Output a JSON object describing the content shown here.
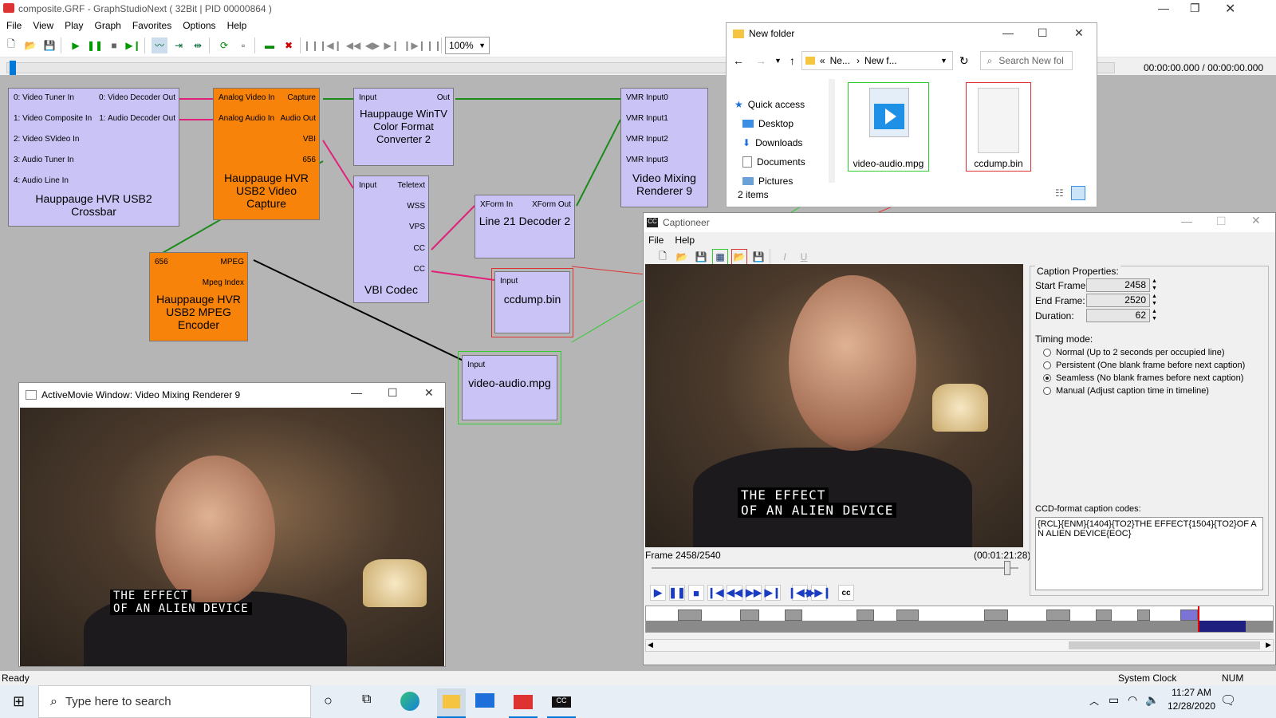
{
  "gsn": {
    "title": "composite.GRF - GraphStudioNext ( 32Bit | PID 00000864 )",
    "menu": [
      "File",
      "View",
      "Play",
      "Graph",
      "Favorites",
      "Options",
      "Help"
    ],
    "zoom": "100%",
    "time": "00:00:00.000 / 00:00:00.000",
    "status": "Ready",
    "status_clock": "System Clock",
    "status_num": "NUM"
  },
  "filters": {
    "crossbar": {
      "name": "Hauppauge HVR USB2 Crossbar",
      "pins_in": [
        "0: Video Tuner In",
        "1: Video Composite In",
        "2: Video SVideo In",
        "3: Audio Tuner In",
        "4: Audio Line In"
      ],
      "pins_out": [
        "0: Video Decoder Out",
        "1: Audio Decoder Out"
      ]
    },
    "capture": {
      "name": "Hauppauge HVR USB2 Video Capture",
      "pins_in": [
        "Analog Video In",
        "Analog Audio In"
      ],
      "pins_out": [
        "Capture",
        "Audio Out",
        "VBI",
        "656"
      ]
    },
    "color": {
      "name": "Hauppauge WinTV Color Format Converter 2",
      "pin_in": "Input",
      "pin_out": "Out"
    },
    "vbi": {
      "name": "VBI Codec",
      "pin_in": "Input",
      "pins_out": [
        "Teletext",
        "WSS",
        "VPS",
        "CC",
        "CC"
      ]
    },
    "line21": {
      "name": "Line 21 Decoder 2",
      "pin_in": "XForm In",
      "pin_out": "XForm Out"
    },
    "vmr": {
      "name": "Video Mixing Renderer 9",
      "pins_in": [
        "VMR Input0",
        "VMR Input1",
        "VMR Input2",
        "VMR Input3"
      ]
    },
    "mpeg": {
      "name": "Hauppauge HVR USB2 MPEG Encoder",
      "pin_in": "656",
      "pins_out": [
        "MPEG",
        "Mpeg Index"
      ]
    },
    "ccdump": {
      "name": "ccdump.bin",
      "pin_in": "Input"
    },
    "vamp": {
      "name": "video-audio.mpg",
      "pin_in": "Input"
    }
  },
  "activemovie": {
    "title": "ActiveMovie Window: Video Mixing Renderer 9",
    "caption_line1": "THE EFFECT",
    "caption_line2": "OF AN ALIEN DEVICE"
  },
  "explorer": {
    "title": "New folder",
    "crumb1": "Ne...",
    "crumb2": "New f...",
    "search_placeholder": "Search New fol",
    "nav": [
      "Quick access",
      "Desktop",
      "Downloads",
      "Documents",
      "Pictures"
    ],
    "files": [
      "video-audio.mpg",
      "ccdump.bin"
    ],
    "count": "2 items"
  },
  "captioneer": {
    "title": "Captioneer",
    "menu": [
      "File",
      "Help"
    ],
    "caption_line1": "THE EFFECT",
    "caption_line2": "OF AN ALIEN DEVICE",
    "frame": "Frame 2458/2540",
    "timecode": "(00:01:21:28)",
    "props_title": "Caption Properties:",
    "start_label": "Start Frame:",
    "start_value": "2458",
    "end_label": "End Frame:",
    "end_value": "2520",
    "dur_label": "Duration:",
    "dur_value": "62",
    "timing_title": "Timing mode:",
    "modes": [
      "Normal (Up to 2 seconds per occupied line)",
      "Persistent (One blank frame before next caption)",
      "Seamless (No blank frames before next caption)",
      "Manual (Adjust caption time in timeline)"
    ],
    "selected_mode": 2,
    "codes_title": "CCD-format caption codes:",
    "codes": "{RCL}{ENM}{1404}{TO2}THE EFFECT{1504}{TO2}OF AN ALIEN DEVICE{EOC}",
    "slider_fraction": 0.97
  },
  "taskbar": {
    "search_placeholder": "Type here to search",
    "time": "11:27 AM",
    "date": "12/28/2020"
  },
  "colors": {
    "filter": "#c9c3f6",
    "orange": "#f7830a",
    "green_link": "#1a8a1a",
    "pink_link": "#e0207a",
    "accent": "#0078d7"
  }
}
